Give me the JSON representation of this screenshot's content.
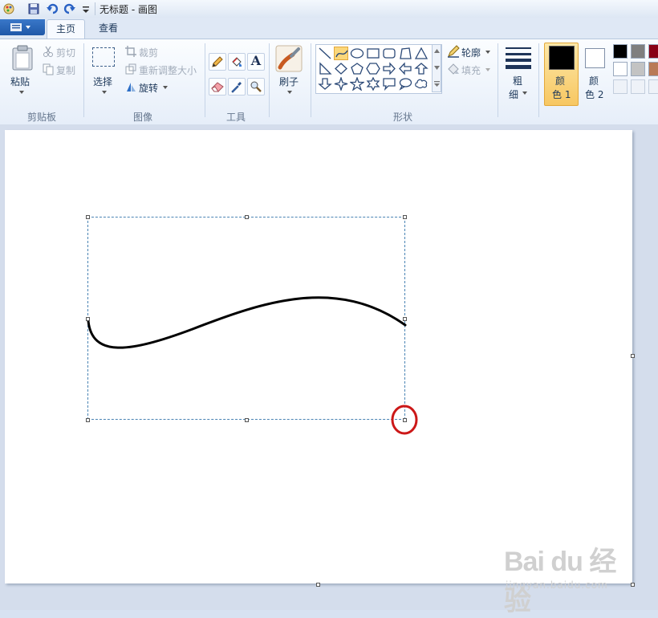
{
  "window": {
    "title": "无标题 - 画图"
  },
  "tabs": [
    {
      "label": "主页"
    },
    {
      "label": "查看"
    }
  ],
  "clipboard": {
    "paste": "粘贴",
    "cut": "剪切",
    "copy": "复制",
    "label": "剪贴板"
  },
  "image": {
    "select": "选择",
    "crop": "裁剪",
    "resize": "重新调整大小",
    "rotate": "旋转",
    "label": "图像"
  },
  "tools": {
    "label": "工具",
    "text_tool": "A"
  },
  "brushes": {
    "label": "刷子"
  },
  "shapes": {
    "outline": "轮廓",
    "fill": "填充",
    "label": "形状",
    "selected": "curve"
  },
  "size": {
    "label_top": "粗",
    "label_bottom": "细"
  },
  "colors": {
    "color1_top": "颜",
    "color1_bottom": "色 1",
    "color2_top": "颜",
    "color2_bottom": "色 2",
    "color1_value": "#000000",
    "color2_value": "#ffffff",
    "palette": [
      "#000000",
      "#7f7f7f",
      "#880015",
      "#ffffff",
      "#c3c3c3",
      "#b97a57",
      "#ffffff",
      "#ffffff",
      "#ffffff"
    ]
  },
  "watermark": {
    "main": "Bai du 经验",
    "sub": "jingyan.baidu.com"
  }
}
